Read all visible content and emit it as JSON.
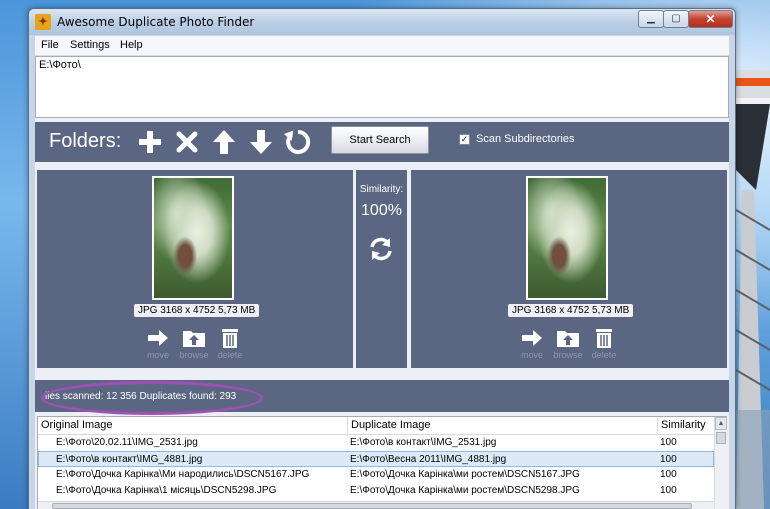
{
  "window": {
    "title": "Awesome Duplicate Photo Finder",
    "minimize": "▁",
    "maximize": "▢",
    "close": "✕"
  },
  "menu": [
    "File",
    "Settings",
    "Help"
  ],
  "folders": {
    "paths": [
      "E:\\Фото\\"
    ]
  },
  "toolbar": {
    "folders_label": "Folders:",
    "start_search": "Start Search",
    "scan_subdirectories": "Scan Subdirectories",
    "scan_subdirectories_checked": true
  },
  "left_image": {
    "info": "JPG  3168 x 4752  5,73 MB",
    "actions": [
      "move",
      "browse",
      "delete"
    ]
  },
  "similarity": {
    "label": "Similarity:",
    "value": "100%"
  },
  "right_image": {
    "info": "JPG  3168 x 4752  5,73 MB",
    "actions": [
      "move",
      "browse",
      "delete"
    ]
  },
  "status": {
    "text": "iles scanned: 12 356  Duplicates found: 293"
  },
  "table": {
    "columns": [
      "Original Image",
      "Duplicate Image",
      "Similarity"
    ],
    "rows": [
      {
        "original": "E:\\Фото\\20.02.11\\IMG_2531.jpg",
        "duplicate": "E:\\Фото\\в контакт\\IMG_2531.jpg",
        "similarity": "100",
        "selected": false
      },
      {
        "original": "E:\\Фото\\в контакт\\IMG_4881.jpg",
        "duplicate": "E:\\Фото\\Весна 2011\\IMG_4881.jpg",
        "similarity": "100",
        "selected": true
      },
      {
        "original": "E:\\Фото\\Дочка Карінка\\Ми народились\\DSCN5167.JPG",
        "duplicate": "E:\\Фото\\Дочка Карінка\\ми ростем\\DSCN5167.JPG",
        "similarity": "100",
        "selected": false
      },
      {
        "original": "E:\\Фото\\Дочка Карінка\\1 місяць\\DSCN5298.JPG",
        "duplicate": "E:\\Фото\\Дочка Карінка\\ми ростем\\DSCN5298.JPG",
        "similarity": "100",
        "selected": false
      }
    ]
  },
  "colors": {
    "panel": "#5b6782",
    "highlight_ellipse": "#a04fb6",
    "selected_row": "#dce9f9"
  }
}
